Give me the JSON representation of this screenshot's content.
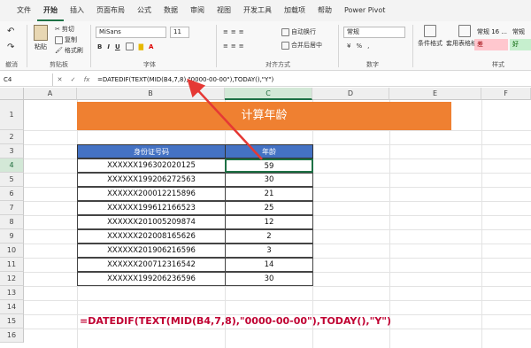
{
  "ribbon_tabs": [
    "文件",
    "开始",
    "插入",
    "页面布局",
    "公式",
    "数据",
    "审阅",
    "视图",
    "开发工具",
    "加载项",
    "帮助",
    "Power Pivot"
  ],
  "clipboard": {
    "paste": "粘贴",
    "cut": "剪切",
    "copy": "复制",
    "format_painter": "格式刷",
    "label": "剪贴板"
  },
  "undo_label": "撤消",
  "font": {
    "name": "MiSans",
    "size": "11",
    "label": "字体"
  },
  "alignment": {
    "wrap": "自动换行",
    "merge": "合并后居中",
    "label": "对齐方式"
  },
  "number": {
    "format": "常规",
    "label": "数字"
  },
  "styles": {
    "conditional": "条件格式",
    "table": "套用表格格式",
    "normal": "常规 16 ...",
    "normal2": "常规",
    "bad": "差",
    "good": "好",
    "label": "样式"
  },
  "formula_bar": {
    "cell_ref": "C4",
    "formula": "=DATEDIF(TEXT(MID(B4,7,8),\"0000-00-00\"),TODAY(),\"Y\")"
  },
  "columns": [
    "A",
    "B",
    "C",
    "D",
    "E",
    "F"
  ],
  "rows": [
    "1",
    "2",
    "3",
    "4",
    "5",
    "6",
    "7",
    "8",
    "9",
    "10",
    "11",
    "12",
    "13",
    "14",
    "15",
    "16"
  ],
  "sheet": {
    "title": "计算年龄",
    "headers": [
      "身份证号码",
      "年龄"
    ],
    "data": [
      [
        "XXXXXX196302020125",
        "59"
      ],
      [
        "XXXXXX199206272563",
        "30"
      ],
      [
        "XXXXXX200012215896",
        "21"
      ],
      [
        "XXXXXX199612166523",
        "25"
      ],
      [
        "XXXXXX201005209874",
        "12"
      ],
      [
        "XXXXXX202008165626",
        "2"
      ],
      [
        "XXXXXX201906216596",
        "3"
      ],
      [
        "XXXXXX200712316542",
        "14"
      ],
      [
        "XXXXXX199206236596",
        "30"
      ]
    ],
    "formula_display": "=DATEDIF(TEXT(MID(B4,7,8),\"0000-00-00\"),TODAY(),\"Y\")"
  },
  "colors": {
    "title_bg": "#ef8031",
    "header_bg": "#4472c4",
    "formula_text": "#c00032",
    "arrow": "#e53935",
    "excel_green": "#1e7145"
  }
}
